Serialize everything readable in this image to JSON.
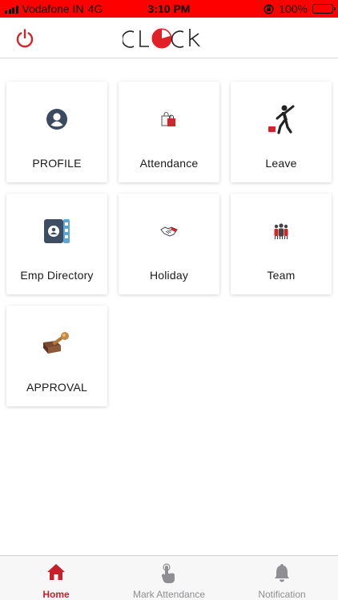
{
  "status_bar": {
    "carrier": "Vodafone IN",
    "network": "4G",
    "time": "3:10 PM",
    "battery": "100%"
  },
  "header": {
    "logo_text": "CLOCK"
  },
  "tiles": [
    {
      "label": "PROFILE",
      "icon": "profile-icon"
    },
    {
      "label": "Attendance",
      "icon": "shopping-bag-icon"
    },
    {
      "label": "Leave",
      "icon": "running-man-icon"
    },
    {
      "label": "Emp Directory",
      "icon": "directory-icon"
    },
    {
      "label": "Holiday",
      "icon": "handshake-icon"
    },
    {
      "label": "Team",
      "icon": "team-icon"
    },
    {
      "label": "APPROVAL",
      "icon": "stamp-icon"
    }
  ],
  "tabbar": {
    "items": [
      {
        "label": "Home",
        "icon": "home-icon",
        "active": true
      },
      {
        "label": "Mark Attendance",
        "icon": "tap-hand-icon",
        "active": false
      },
      {
        "label": "Notification",
        "icon": "bell-icon",
        "active": false
      }
    ]
  },
  "colors": {
    "status_bar": "#ff0000",
    "accent": "#c8202a",
    "inactive_tab": "#8e8e93"
  }
}
